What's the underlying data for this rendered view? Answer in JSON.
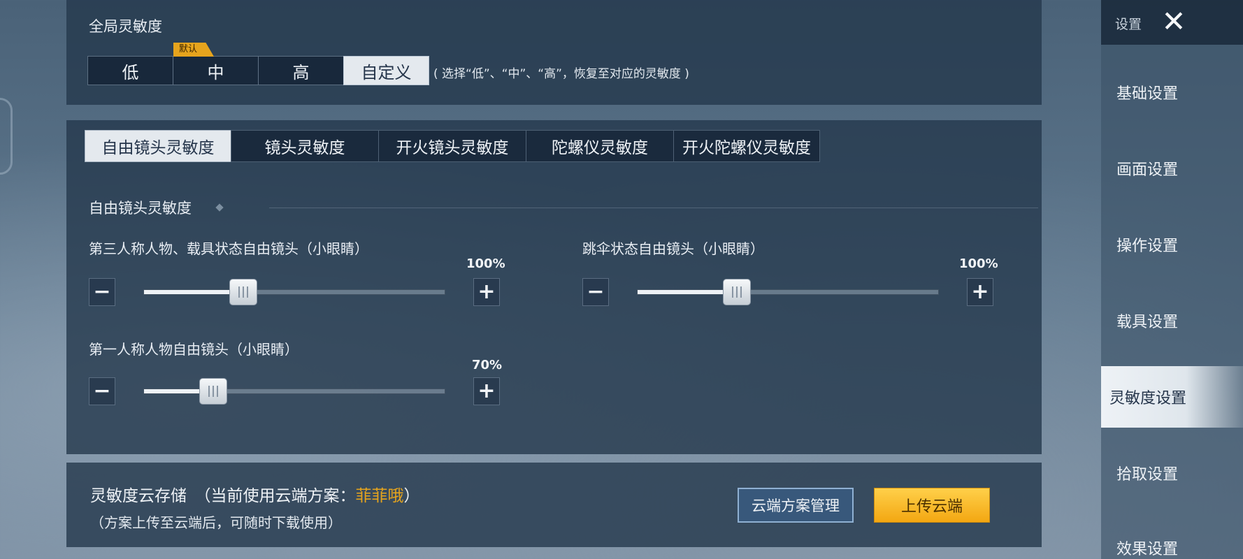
{
  "global": {
    "title": "全局灵敏度",
    "default_tag": "默认",
    "options": [
      "低",
      "中",
      "高",
      "自定义"
    ],
    "selected": "自定义",
    "hint": "( 选择“低”、“中”、“高”，恢复至对应的灵敏度 )"
  },
  "tabs": [
    "自由镜头灵敏度",
    "镜头灵敏度",
    "开火镜头灵敏度",
    "陀螺仪灵敏度",
    "开火陀螺仪灵敏度"
  ],
  "active_tab": "自由镜头灵敏度",
  "section": {
    "title": "自由镜头灵敏度",
    "sliders": [
      {
        "label": "第三人称人物、载具状态自由镜头（小眼睛）",
        "value_text": "100%",
        "level": 0.33
      },
      {
        "label": "跳伞状态自由镜头（小眼睛）",
        "value_text": "100%",
        "level": 0.33
      },
      {
        "label": "第一人称人物自由镜头（小眼睛）",
        "value_text": "70%",
        "level": 0.23
      }
    ],
    "minus": "−",
    "plus": "+"
  },
  "cloud": {
    "title_prefix": "灵敏度云存储　（当前使用云端方案：",
    "plan_name": "菲菲哦",
    "title_suffix": "）",
    "subtitle": "（方案上传至云端后，可随时下载使用）",
    "manage_label": "云端方案管理",
    "upload_label": "上传云端"
  },
  "sidebar": {
    "title": "设置",
    "close_glyph": "✕",
    "items": [
      "基础设置",
      "画面设置",
      "操作设置",
      "载具设置",
      "灵敏度设置",
      "拾取设置",
      "效果设置"
    ],
    "active": "灵敏度设置"
  },
  "colors": {
    "accent": "#e6a41d",
    "upload_button": "#f3a712",
    "active_bg": "#e4e9ee"
  }
}
